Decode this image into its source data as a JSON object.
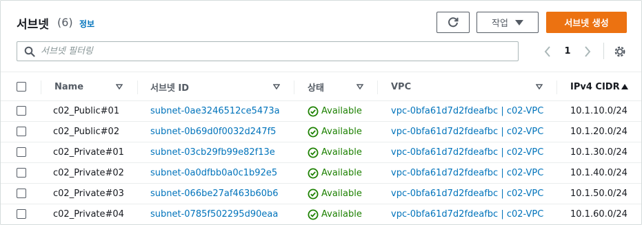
{
  "header": {
    "title": "서브넷",
    "count": "(6)",
    "info_link": "정보",
    "actions_label": "작업",
    "create_label": "서브넷 생성"
  },
  "search": {
    "placeholder": "서브넷 필터링"
  },
  "pagination": {
    "current_page": "1"
  },
  "columns": [
    {
      "label": "Name"
    },
    {
      "label": "서브넷 ID"
    },
    {
      "label": "상태"
    },
    {
      "label": "VPC"
    },
    {
      "label": "IPv4 CIDR"
    }
  ],
  "rows": [
    {
      "name": "c02_Public#01",
      "subnet_id": "subnet-0ae3246512ce5473a",
      "state": "Available",
      "vpc": "vpc-0bfa61d7d2fdeafbc | c02-VPC",
      "cidr": "10.1.10.0/24"
    },
    {
      "name": "c02_Public#02",
      "subnet_id": "subnet-0b69d0f0032d247f5",
      "state": "Available",
      "vpc": "vpc-0bfa61d7d2fdeafbc | c02-VPC",
      "cidr": "10.1.20.0/24"
    },
    {
      "name": "c02_Private#01",
      "subnet_id": "subnet-03cb29fb99e82f13e",
      "state": "Available",
      "vpc": "vpc-0bfa61d7d2fdeafbc | c02-VPC",
      "cidr": "10.1.30.0/24"
    },
    {
      "name": "c02_Private#02",
      "subnet_id": "subnet-0a0dfbb0a0c1b92e5",
      "state": "Available",
      "vpc": "vpc-0bfa61d7d2fdeafbc | c02-VPC",
      "cidr": "10.1.40.0/24"
    },
    {
      "name": "c02_Private#03",
      "subnet_id": "subnet-066be27af463b60b6",
      "state": "Available",
      "vpc": "vpc-0bfa61d7d2fdeafbc | c02-VPC",
      "cidr": "10.1.50.0/24"
    },
    {
      "name": "c02_Private#04",
      "subnet_id": "subnet-0785f502295d90eaa",
      "state": "Available",
      "vpc": "vpc-0bfa61d7d2fdeafbc | c02-VPC",
      "cidr": "10.1.60.0/24"
    }
  ],
  "colors": {
    "accent": "#ec7211",
    "link": "#0073bb",
    "status_ok": "#1d8102"
  },
  "icons": {
    "refresh": "refresh-icon",
    "dropdown": "caret-down-icon",
    "search": "search-icon",
    "prev": "chevron-left-icon",
    "next": "chevron-right-icon",
    "settings": "gear-icon",
    "filter": "caret-down-outline-icon",
    "sort_asc": "caret-up-icon",
    "status": "check-circle-icon"
  }
}
